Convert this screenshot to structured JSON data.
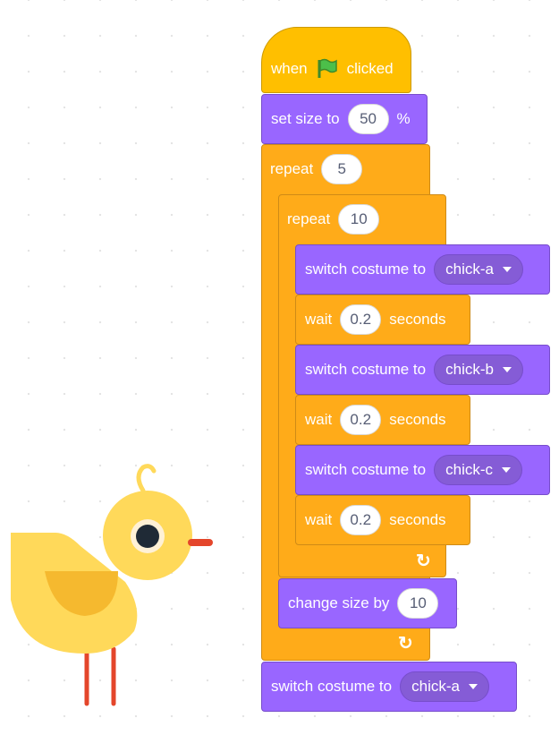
{
  "hat": {
    "when": "when",
    "clicked": "clicked",
    "flag_icon": "green-flag-icon"
  },
  "set_size": {
    "label": "set size to",
    "value": "50",
    "unit": "%"
  },
  "outer_repeat": {
    "label": "repeat",
    "value": "5"
  },
  "inner_repeat": {
    "label": "repeat",
    "value": "10"
  },
  "inner_blocks": [
    {
      "type": "costume",
      "label": "switch costume to",
      "value": "chick-a"
    },
    {
      "type": "wait",
      "label": "wait",
      "value": "0.2",
      "unit": "seconds"
    },
    {
      "type": "costume",
      "label": "switch costume to",
      "value": "chick-b"
    },
    {
      "type": "wait",
      "label": "wait",
      "value": "0.2",
      "unit": "seconds"
    },
    {
      "type": "costume",
      "label": "switch costume to",
      "value": "chick-c"
    },
    {
      "type": "wait",
      "label": "wait",
      "value": "0.2",
      "unit": "seconds"
    }
  ],
  "change_size": {
    "label": "change size by",
    "value": "10"
  },
  "final_costume": {
    "label": "switch costume to",
    "value": "chick-a"
  },
  "colors": {
    "motion_looks": "#9966ff",
    "control": "#ffab19",
    "events": "#ffbf00",
    "chick": "#ffd95a"
  },
  "sprite": "chick"
}
